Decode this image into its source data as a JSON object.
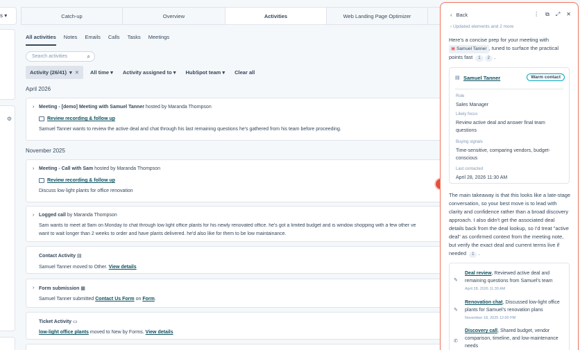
{
  "left_column": {
    "top_label": "s",
    "settings_icon": "gear-icon"
  },
  "tabs": [
    {
      "label": "Catch-up",
      "active": false
    },
    {
      "label": "Overview",
      "active": false
    },
    {
      "label": "Activities",
      "active": true
    },
    {
      "label": "Web Landing Page Optimizer",
      "active": false
    }
  ],
  "subtabs": [
    "All activities",
    "Notes",
    "Emails",
    "Calls",
    "Tasks",
    "Meetings"
  ],
  "search": {
    "placeholder": "Search activities"
  },
  "filters": {
    "activity_chip": "Activity (26/41)",
    "all_time": "All time",
    "assigned": "Activity assigned to",
    "team": "HubSpot team",
    "clear": "Clear all"
  },
  "groups": [
    {
      "date": "April 2026"
    },
    {
      "date": "November 2025"
    }
  ],
  "activities": [
    {
      "title": "Meeting - [demo] Meeting with Samuel Tanner",
      "byline": "hosted by Maranda Thompson",
      "link": "Review recording & follow up",
      "body": "Samuel Tanner wants to review the active deal and chat through his last remaining questions he's gathered from his team before proceeding."
    },
    {
      "title": "Meeting - Call with Sam",
      "byline": "hosted by Maranda Thompson",
      "link": "Review recording & follow up",
      "body": "Discuss low light plants for office renovation"
    },
    {
      "title": "Logged call",
      "byline": "by Maranda Thompson",
      "body": "Sam wants to meet at 9am on Monday to chat through low light office plants for his newly renovated office. he's got a limited budget and is window shopping with a few other ve",
      "body2": "want to wait longer than 2 weeks to order and have plants delivered. he'd also like for them to be low maintainance."
    },
    {
      "title": "Contact Activity",
      "body_prefix": "Samuel Tanner moved to Other.",
      "link": "View details"
    },
    {
      "title": "Form submission",
      "body_prefix": "Samuel Tanner submitted",
      "link": "Contact Us Form",
      "mid": "on",
      "link2": "Form",
      "end": "."
    },
    {
      "title": "Ticket Activity",
      "link": "low-light office plants",
      "body_mid": "moved to New by Forms.",
      "link2": "View details"
    }
  ],
  "sidebar": {
    "back": "Back",
    "updated": "Updated elements and 2 more",
    "intro_1": "Here's a concise prep for your meeting with",
    "contact_pill": "Samuel Tanner",
    "intro_2": ", tuned to surface the practical points",
    "intro_3": "fast",
    "cite1": "1",
    "cite2": "2",
    "card": {
      "name": "Samuel Tanner",
      "badge": "Warm contact",
      "role_label": "Role",
      "role": "Sales Manager",
      "focus_label": "Likely focus",
      "focus": "Review active deal and answer final team questions",
      "signals_label": "Buying signals",
      "signals": "Time-sensitive, comparing vendors, budget-conscious",
      "contacted_label": "Last contacted",
      "contacted": "April 28, 2026 11:30 AM"
    },
    "takeaway": "The main takeaway is that this looks like a late-stage conversation, so your best move is to lead with clarity and confidence rather than a broad discovery approach. I also didn't get the associated deal details back from the deal lookup, so I'd treat \"active deal\" as confirmed context from the meeting note, but verify the exact deal and current terms live if needed",
    "takeaway_cite": "1",
    "refs": [
      {
        "link": "Deal review",
        "text": ", Reviewed active deal and remaining questions from Samuel's team",
        "date": "April 28, 2026 11:30 AM"
      },
      {
        "link": "Renovation chat",
        "text": ", Discussed low-light office plants for Samuel's renovation plans",
        "date": "November 18, 2025 12:00 PM"
      },
      {
        "link": "Discovery call",
        "text": ", Shared budget, vendor comparison, timeline, and low-maintenance needs",
        "date": ""
      }
    ]
  }
}
